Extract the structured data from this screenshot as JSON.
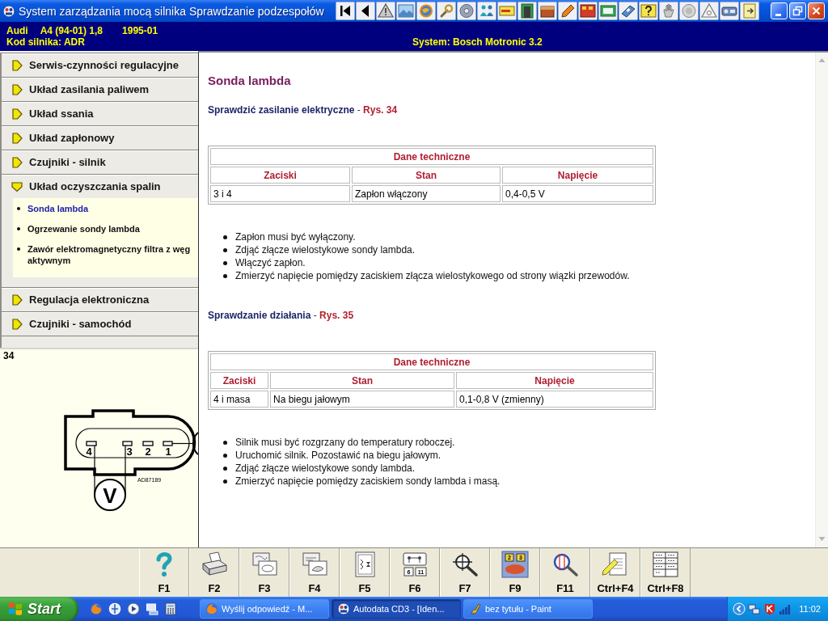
{
  "window": {
    "app_title": "System zarządzania mocą silnika",
    "section_title": "Sprawdzanie podzespołów"
  },
  "vehicle": {
    "make": "Audi",
    "model": "A4 (94-01) 1,8",
    "years": "1995-01",
    "engine_code": "Kod silnika: ADR",
    "system": "System: Bosch Motronic 3.2"
  },
  "sidebar": {
    "items": [
      {
        "label": "Serwis-czynności regulacyjne",
        "expanded": false
      },
      {
        "label": "Układ zasilania paliwem",
        "expanded": false
      },
      {
        "label": "Układ ssania",
        "expanded": false
      },
      {
        "label": "Układ zapłonowy",
        "expanded": false
      },
      {
        "label": "Czujniki - silnik",
        "expanded": false
      },
      {
        "label": "Układ oczyszczania spalin",
        "expanded": true,
        "children": [
          {
            "label": "Sonda lambda",
            "selected": true
          },
          {
            "label": "Ogrzewanie sondy lambda",
            "selected": false
          },
          {
            "label": "Zawór elektromagnetyczny filtra z węg aktywnym",
            "selected": false
          }
        ]
      },
      {
        "label": "Regulacja elektroniczna",
        "expanded": false
      },
      {
        "label": "Czujniki - samochód",
        "expanded": false
      }
    ]
  },
  "figure": {
    "number": "34",
    "pin_labels": [
      "4",
      "3",
      "2",
      "1"
    ],
    "meter_label": "V",
    "drawing_code": "AD87189"
  },
  "content": {
    "title": "Sonda lambda",
    "sections": [
      {
        "heading": "Sprawdzić zasilanie elektryczne",
        "separator": "-",
        "figure_ref": "Rys. 34",
        "table": {
          "caption": "Dane techniczne",
          "columns": [
            "Zaciski",
            "Stan",
            "Napięcie"
          ],
          "rows": [
            [
              "3 i 4",
              "Zapłon włączony",
              "0,4-0,5 V"
            ]
          ]
        },
        "steps": [
          "Zapłon musi być wyłączony.",
          "Zdjąć złącze wielostykowe sondy lambda.",
          "Włączyć zapłon.",
          "Zmierzyć napięcie pomiędzy zaciskiem złącza wielostykowego od strony wiązki przewodów."
        ]
      },
      {
        "heading": "Sprawdzanie działania",
        "separator": "-",
        "figure_ref": "Rys. 35",
        "table": {
          "caption": "Dane techniczne",
          "columns": [
            "Zaciski",
            "Stan",
            "Napięcie"
          ],
          "rows": [
            [
              "4 i masa",
              "Na biegu jałowym",
              "0,1-0,8 V (zmienny)"
            ]
          ]
        },
        "steps": [
          "Silnik musi być rozgrzany do temperatury roboczej.",
          "Uruchomić silnik. Pozostawić na biegu jałowym.",
          "Zdjąć złącze wielostykowe sondy lambda.",
          "Zmierzyć napięcie pomiędzy zaciskiem sondy lambda i masą."
        ]
      }
    ]
  },
  "function_keys": [
    {
      "label": "F1"
    },
    {
      "label": "F2"
    },
    {
      "label": "F3"
    },
    {
      "label": "F4"
    },
    {
      "label": "F5"
    },
    {
      "label": "F6",
      "icon_numbers": [
        "6",
        "11"
      ]
    },
    {
      "label": "F7"
    },
    {
      "label": "F9",
      "icon_numbers": [
        "2",
        "3"
      ]
    },
    {
      "label": "F11"
    },
    {
      "label": "Ctrl+F4"
    },
    {
      "label": "Ctrl+F8"
    }
  ],
  "taskbar": {
    "start": "Start",
    "tasks": [
      {
        "label": "Wyślij odpowiedź - M...",
        "selected": false
      },
      {
        "label": "Autodata CD3 - [Iden...",
        "selected": true
      },
      {
        "label": "bez tytułu - Paint",
        "selected": false
      }
    ],
    "clock": "11:02"
  }
}
